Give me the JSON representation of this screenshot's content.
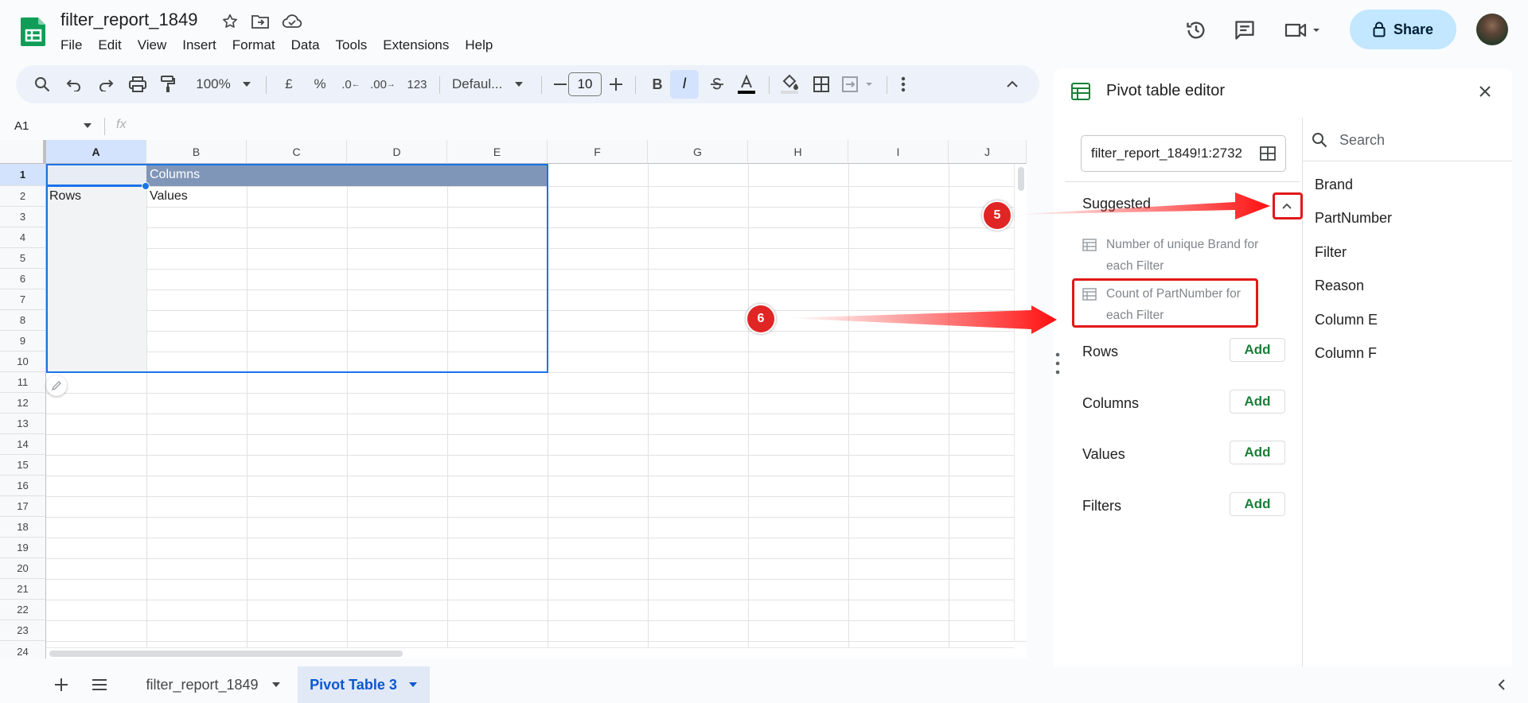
{
  "document": {
    "title": "filter_report_1849"
  },
  "menu": [
    "File",
    "Edit",
    "View",
    "Insert",
    "Format",
    "Data",
    "Tools",
    "Extensions",
    "Help"
  ],
  "share": {
    "label": "Share"
  },
  "toolbar": {
    "zoom": "100%",
    "currency": "£",
    "percent": "%",
    "dec_decrease": ".0",
    "dec_increase": ".00",
    "number_format": "123",
    "font": "Defaul...",
    "font_size": "10",
    "bold": "B",
    "italic": "I"
  },
  "formula_bar": {
    "cell_ref": "A1",
    "fx": "fx"
  },
  "columns": [
    "A",
    "B",
    "C",
    "D",
    "E",
    "F",
    "G",
    "H",
    "I",
    "J"
  ],
  "rows": [
    "1",
    "2",
    "3",
    "4",
    "5",
    "6",
    "7",
    "8",
    "9",
    "10",
    "11",
    "12",
    "13",
    "14",
    "15",
    "16",
    "17",
    "18",
    "19",
    "20",
    "21",
    "22",
    "23",
    "24"
  ],
  "cells": {
    "b1": "Columns",
    "a2": "Rows",
    "b2": "Values"
  },
  "sheet_tabs": [
    {
      "label": "filter_report_1849",
      "active": false
    },
    {
      "label": "Pivot Table 3",
      "active": true
    }
  ],
  "pivot_editor": {
    "title": "Pivot table editor",
    "range": "filter_report_1849!1:2732",
    "search_placeholder": "Search",
    "fields": [
      "Brand",
      "PartNumber",
      "Filter",
      "Reason",
      "Column E",
      "Column F"
    ],
    "suggested_label": "Suggested",
    "suggestions": [
      {
        "line1": "Number of unique Brand for",
        "line2": "each Filter"
      },
      {
        "line1": "Count of PartNumber for",
        "line2": "each Filter"
      }
    ],
    "sections": [
      {
        "label": "Rows",
        "add": "Add"
      },
      {
        "label": "Columns",
        "add": "Add"
      },
      {
        "label": "Values",
        "add": "Add"
      },
      {
        "label": "Filters",
        "add": "Add"
      }
    ]
  },
  "annotations": {
    "step5": "5",
    "step6": "6"
  },
  "colors": {
    "accent": "#0b57d0",
    "header_fill": "#8096b8",
    "annotation_red": "#e02525",
    "add_green": "#188038",
    "share_bg": "#c2e7ff"
  }
}
